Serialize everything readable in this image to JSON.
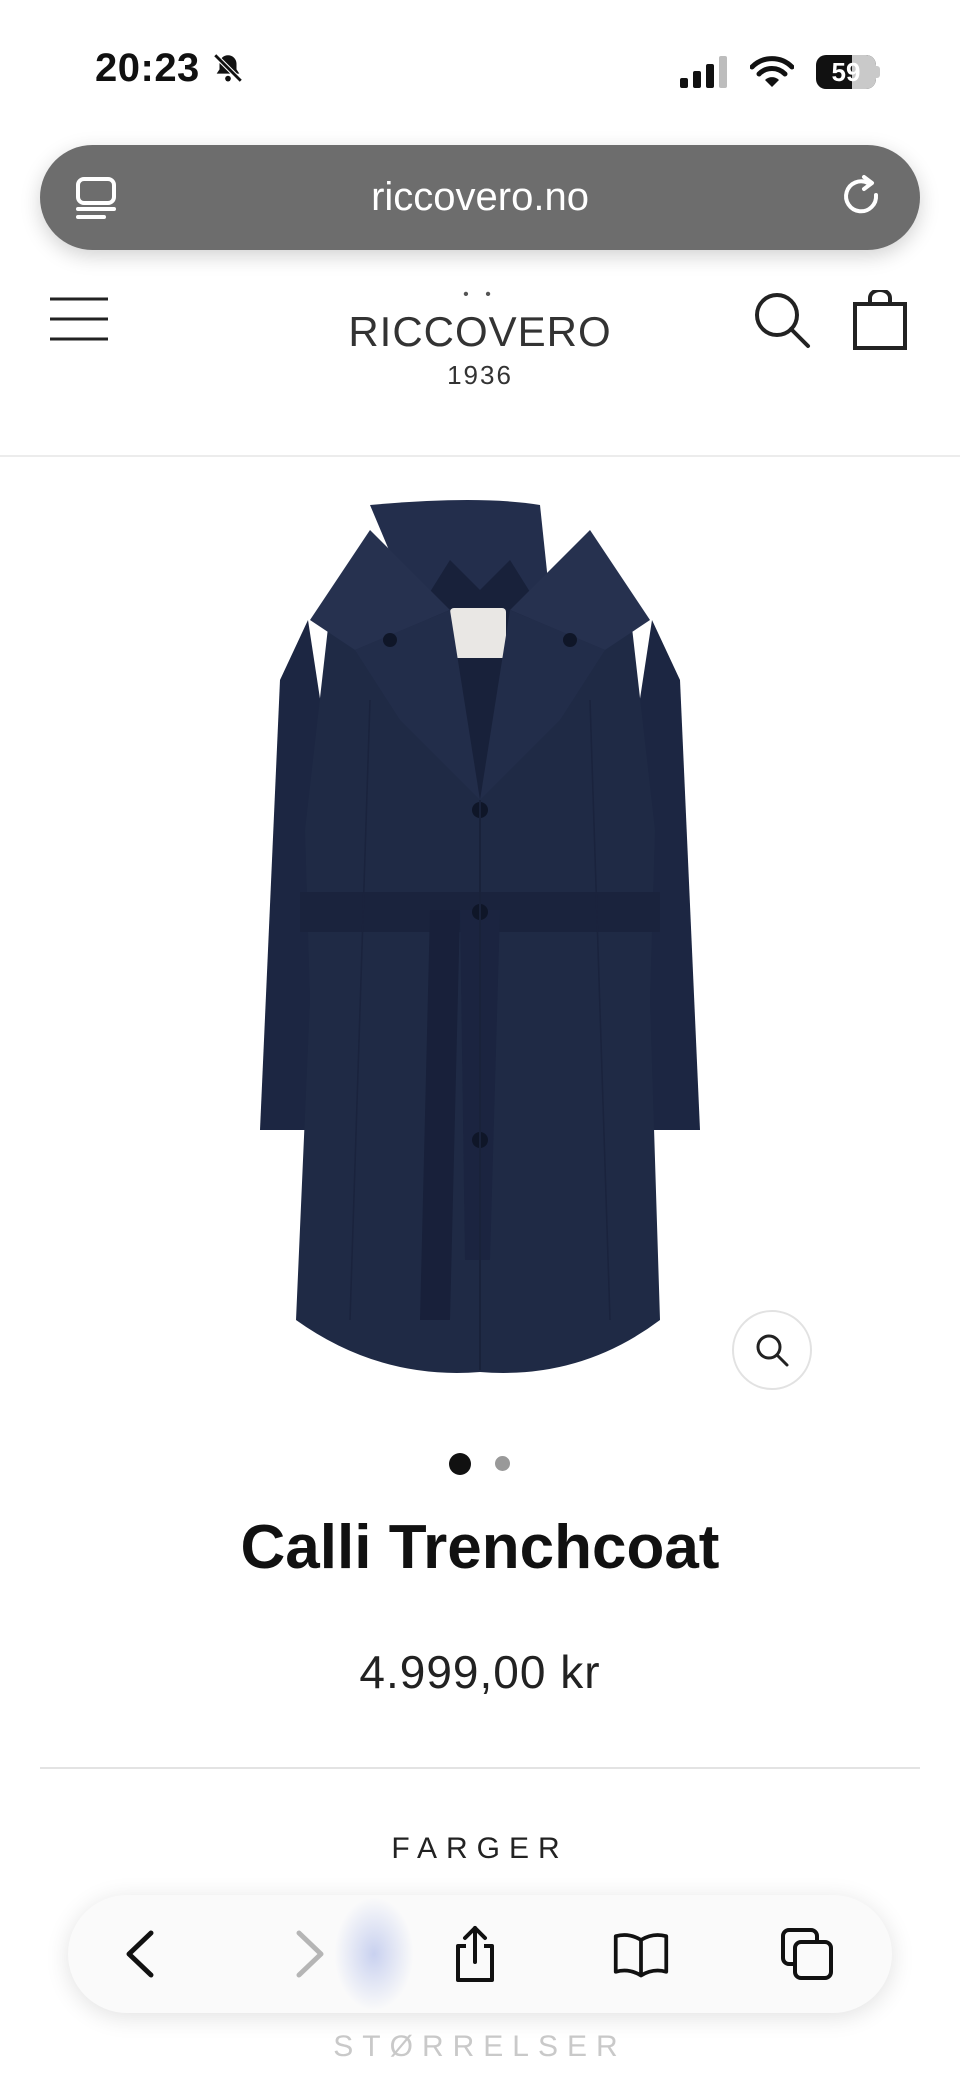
{
  "status_bar": {
    "time": "20:23",
    "battery": "59"
  },
  "browser": {
    "url": "riccovero.no"
  },
  "site": {
    "logo_name": "RICCOVERO",
    "logo_year": "1936"
  },
  "product": {
    "title": "Calli Trenchcoat",
    "price": "4.999,00 kr",
    "gallery": {
      "current_index": 1,
      "total_images": 2
    },
    "colors_label": "FARGER",
    "sizes_label": "STØRRELSER"
  },
  "colors": {
    "coat": "#1f2a45",
    "accent_dark": "#111111"
  }
}
